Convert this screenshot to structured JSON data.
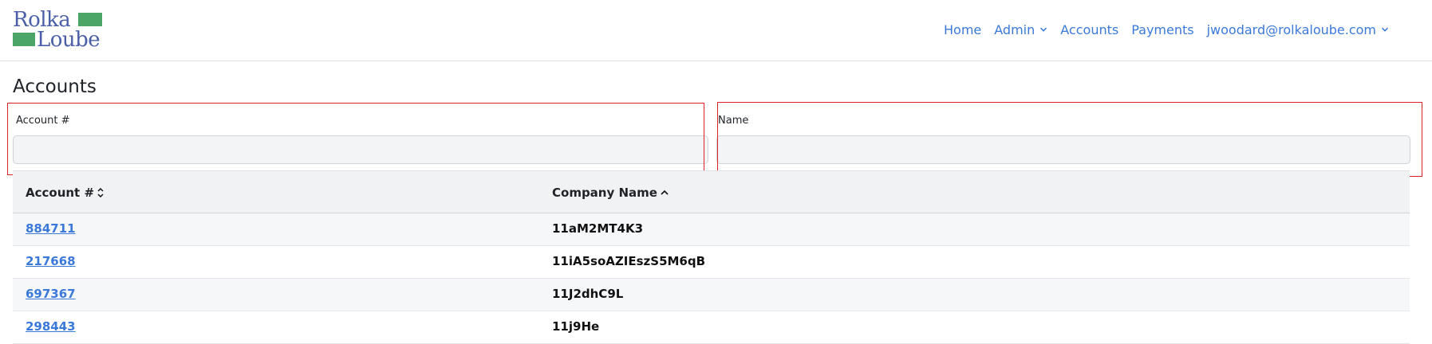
{
  "brand": {
    "logo_line1": "Rolka",
    "logo_line2": "Loube",
    "logo_green": "#4ba567",
    "logo_blue": "#4a5fa8"
  },
  "nav": {
    "items": [
      {
        "label": "Home",
        "icon": null
      },
      {
        "label": "Admin",
        "icon": "chevron-down-icon"
      },
      {
        "label": "Accounts",
        "icon": null
      },
      {
        "label": "Payments",
        "icon": null
      },
      {
        "label": "jwoodard@rolkaloube.com",
        "icon": "chevron-down-icon"
      }
    ],
    "link_color": "#3b79d9"
  },
  "page": {
    "title": "Accounts"
  },
  "filters": {
    "account_label": "Account #",
    "account_value": "",
    "name_label": "Name",
    "name_value": ""
  },
  "table": {
    "headers": [
      {
        "label": "Account #",
        "sort_icon": "sort-both-icon"
      },
      {
        "label": "Company Name",
        "sort_icon": "sort-up-icon"
      }
    ],
    "rows": [
      {
        "account": "884711",
        "name": "11aM2MT4K3"
      },
      {
        "account": "217668",
        "name": "11iA5soAZIEszS5M6qB"
      },
      {
        "account": "697367",
        "name": "11J2dhC9L"
      },
      {
        "account": "298443",
        "name": "11j9He"
      }
    ]
  },
  "highlight_color": "#e0202a"
}
